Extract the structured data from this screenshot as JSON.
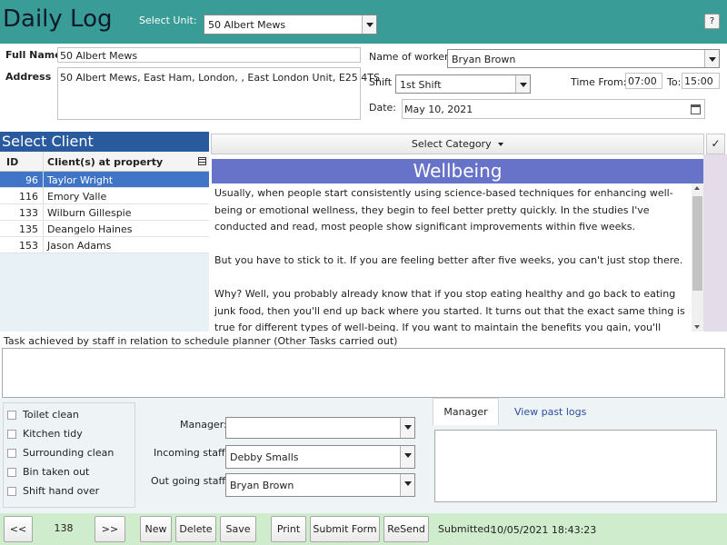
{
  "header": {
    "title": "Daily Log",
    "unit_label": "Select Unit:",
    "unit_value": "50 Albert Mews",
    "help_label": "?"
  },
  "form": {
    "full_name_label": "Full Name",
    "full_name_value": "50 Albert Mews",
    "address_label": "Address",
    "address_value": "50 Albert Mews, East Ham, London, , East London Unit, E25 4TS",
    "worker_label": "Name of worker",
    "worker_value": "Bryan  Brown",
    "shift_label": "Shift",
    "shift_value": "1st Shift",
    "time_from_label": "Time From:",
    "time_from_value": "07:00",
    "to_label": "To:",
    "to_value": "15:00",
    "date_label": "Date:",
    "date_value": "May 10, 2021"
  },
  "clients": {
    "title": "Select Client",
    "col_id": "ID",
    "col_name": "Client(s) at property",
    "rows": [
      {
        "id": "96",
        "name": "Taylor Wright",
        "selected": true
      },
      {
        "id": "116",
        "name": "Emory Valle"
      },
      {
        "id": "133",
        "name": "Wilburn Gillespie"
      },
      {
        "id": "135",
        "name": "Deangelo Haines"
      },
      {
        "id": "153",
        "name": "Jason Adams"
      }
    ]
  },
  "category": {
    "select_label": "Select Category",
    "check_label": "✓",
    "title": "Wellbeing",
    "paragraphs": [
      "Usually, when people start consistently using science-based techniques for enhancing well-being or emotional wellness, they begin to feel better pretty quickly. In the studies I've conducted and read, most people show significant improvements within five weeks.",
      "But you have to stick to it. If you are feeling better after five weeks, you can't just stop there.",
      "Why? Well, you probably already know that if you stop eating healthy and go back to eating junk food, then you'll end up back where you started. It turns out that the exact same thing is true for different types of well-being. If you want to maintain the benefits you gain, you'll have to continue to engage in"
    ]
  },
  "tasks": {
    "label": "Task achieved by staff in relation to schedule planner (Other Tasks carried out)",
    "value": ""
  },
  "checklist": [
    {
      "label": "Toilet clean",
      "checked": false
    },
    {
      "label": "Kitchen tidy",
      "checked": false
    },
    {
      "label": "Surrounding clean",
      "checked": false
    },
    {
      "label": "Bin taken out",
      "checked": false
    },
    {
      "label": "Shift hand over",
      "checked": false
    }
  ],
  "staff": {
    "manager_label": "Manager:",
    "manager_value": "",
    "incoming_label": "Incoming staff:",
    "incoming_value": "Debby  Smalls",
    "outgoing_label": "Out going staff:",
    "outgoing_value": "Bryan  Brown"
  },
  "tabs": {
    "manager": "Manager",
    "past_logs": "View past logs",
    "manager_notes": ""
  },
  "footer": {
    "prev": "<<",
    "record": "138",
    "next": ">>",
    "new": "New",
    "delete": "Delete",
    "save": "Save",
    "print": "Print",
    "submit": "Submit Form",
    "resend": "ReSend",
    "submitted_label": "Submitted:",
    "submitted_value": "10/05/2021 18:43:23"
  },
  "colors": {
    "header": "#3a9c96",
    "client_header": "#2a5a9e",
    "selected_row": "#3f74c6",
    "category_title": "#6673c8",
    "footer": "#cfeccc"
  }
}
